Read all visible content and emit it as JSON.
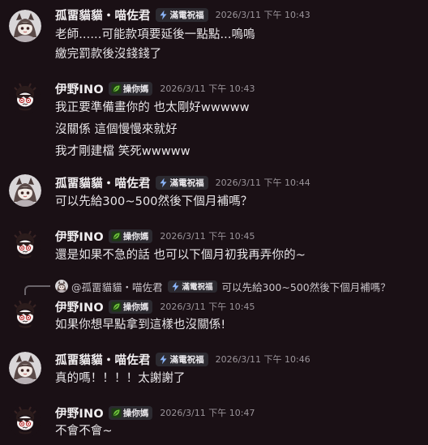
{
  "messages": [
    {
      "author": "孤畱貓貓・喵佐君",
      "badge": "滿電祝福",
      "badge_icon": "lightning-icon",
      "time": "2026/3/11 下午 10:43",
      "lines": [
        "老師......可能款項要延後一點點...嗚嗚",
        "繳完罰款後沒錢錢了"
      ]
    },
    {
      "author": "伊野INO",
      "badge": "操你媽",
      "badge_icon": "leaf-icon",
      "time": "2026/3/11 下午 10:43",
      "lines": [
        "我正要準備畫你的 也太剛好wwwww",
        "沒關係 這個慢慢來就好",
        "我才剛建檔 笑死wwwww"
      ]
    },
    {
      "author": "孤畱貓貓・喵佐君",
      "badge": "滿電祝福",
      "badge_icon": "lightning-icon",
      "time": "2026/3/11 下午 10:44",
      "lines": [
        "可以先給300~500然後下個月補嗎？"
      ]
    },
    {
      "author": "伊野INO",
      "badge": "操你媽",
      "badge_icon": "leaf-icon",
      "time": "2026/3/11 下午 10:45",
      "lines": [
        "還是如果不急的話 也可以下個月初我再弄你的~"
      ]
    },
    {
      "author": "伊野INO",
      "badge": "操你媽",
      "badge_icon": "leaf-icon",
      "time": "2026/3/11 下午 10:45",
      "lines": [
        "如果你想早點拿到這樣也沒關係!"
      ],
      "reply": {
        "author": "@孤畱貓貓・喵佐君",
        "badge": "滿電祝福",
        "text": "可以先給300~500然後下個月補嗎？"
      }
    },
    {
      "author": "孤畱貓貓・喵佐君",
      "badge": "滿電祝福",
      "badge_icon": "lightning-icon",
      "time": "2026/3/11 下午 10:46",
      "lines": [
        "真的嗎！！！！太謝謝了"
      ]
    },
    {
      "author": "伊野INO",
      "badge": "操你媽",
      "badge_icon": "leaf-icon",
      "time": "2026/3/11 下午 10:47",
      "lines": [
        "不會不會~"
      ]
    }
  ],
  "colors": {
    "background": "#1a1015",
    "text": "#e9e6e9",
    "timestamp": "#9a949a",
    "badge_bg": "#2c2a30",
    "lightning": "#8ab4f8",
    "leaf": "#6ec43a"
  }
}
